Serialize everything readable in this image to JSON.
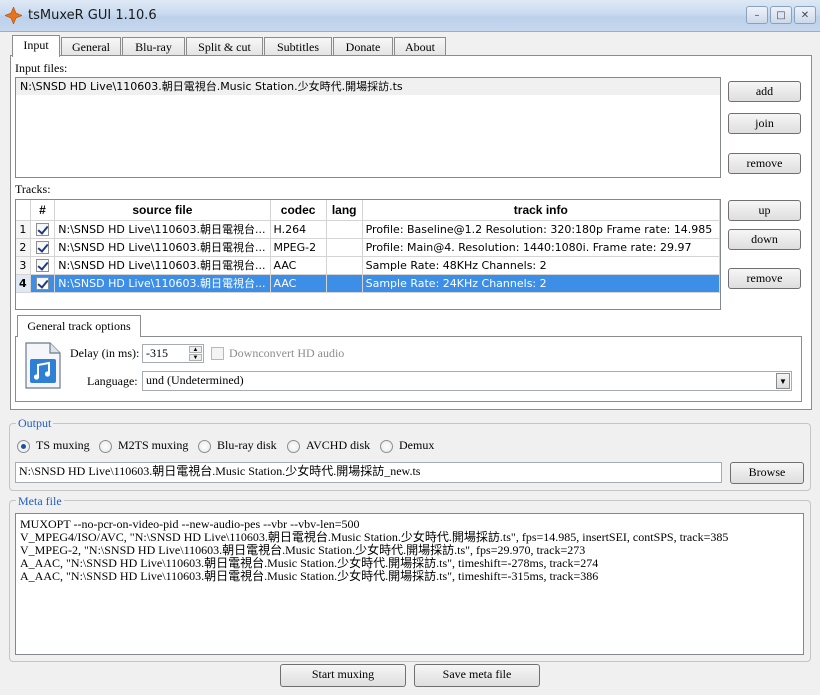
{
  "window": {
    "title": "tsMuxeR GUI 1.10.6",
    "buttons": [
      "minimize-icon",
      "maximize-icon",
      "close-icon"
    ]
  },
  "tabs": [
    "Input",
    "General",
    "Blu-ray",
    "Split & cut",
    "Subtitles",
    "Donate",
    "About"
  ],
  "input_files": {
    "label": "Input files:",
    "items": [
      "N:\\SNSD HD Live\\110603.朝日電視台.Music Station.少女時代.開場採訪.ts"
    ],
    "buttons": {
      "add": "add",
      "join": "join",
      "remove": "remove"
    }
  },
  "tracks": {
    "label": "Tracks:",
    "columns": [
      "#",
      "source file",
      "codec",
      "lang",
      "track info"
    ],
    "rows": [
      {
        "n": "1",
        "checked": true,
        "source": "N:\\SNSD HD Live\\110603.朝日電視台...",
        "codec": "H.264",
        "lang": "",
        "info": "Profile: Baseline@1.2  Resolution: 320:180p  Frame rate: 14.985"
      },
      {
        "n": "2",
        "checked": true,
        "source": "N:\\SNSD HD Live\\110603.朝日電視台...",
        "codec": "MPEG-2",
        "lang": "",
        "info": "Profile: Main@4. Resolution: 1440:1080i. Frame rate: 29.97"
      },
      {
        "n": "3",
        "checked": true,
        "source": "N:\\SNSD HD Live\\110603.朝日電視台...",
        "codec": "AAC",
        "lang": "",
        "info": "Sample Rate: 48KHz  Channels: 2"
      },
      {
        "n": "4",
        "checked": true,
        "source": "N:\\SNSD HD Live\\110603.朝日電視台...",
        "codec": "AAC",
        "lang": "",
        "info": "Sample Rate: 24KHz  Channels: 2",
        "selected": true
      }
    ],
    "buttons": {
      "up": "up",
      "down": "down",
      "remove": "remove"
    }
  },
  "track_options": {
    "tab": "General track options",
    "delay_label": "Delay (in ms):",
    "delay_value": "-315",
    "downconvert_label": "Downconvert HD audio",
    "language_label": "Language:",
    "language_value": "und (Undetermined)"
  },
  "output": {
    "title": "Output",
    "options": [
      "TS muxing",
      "M2TS muxing",
      "Blu-ray disk",
      "AVCHD disk",
      "Demux"
    ],
    "selected": "TS muxing",
    "path": "N:\\SNSD HD Live\\110603.朝日電視台.Music Station.少女時代.開場採訪_new.ts",
    "browse": "Browse"
  },
  "meta": {
    "title": "Meta file",
    "lines": [
      "MUXOPT --no-pcr-on-video-pid --new-audio-pes --vbr  --vbv-len=500",
      "V_MPEG4/ISO/AVC, \"N:\\SNSD HD Live\\110603.朝日電視台.Music Station.少女時代.開場採訪.ts\", fps=14.985, insertSEI, contSPS, track=385",
      "V_MPEG-2, \"N:\\SNSD HD Live\\110603.朝日電視台.Music Station.少女時代.開場採訪.ts\", fps=29.970, track=273",
      "A_AAC, \"N:\\SNSD HD Live\\110603.朝日電視台.Music Station.少女時代.開場採訪.ts\", timeshift=-278ms, track=274",
      "A_AAC, \"N:\\SNSD HD Live\\110603.朝日電視台.Music Station.少女時代.開場採訪.ts\", timeshift=-315ms, track=386"
    ]
  },
  "footer": {
    "start": "Start muxing",
    "save": "Save meta file"
  },
  "colors": {
    "selection": "#3d8ee6",
    "group_title": "#1f5fbf",
    "app_icon": "#e8731a"
  }
}
